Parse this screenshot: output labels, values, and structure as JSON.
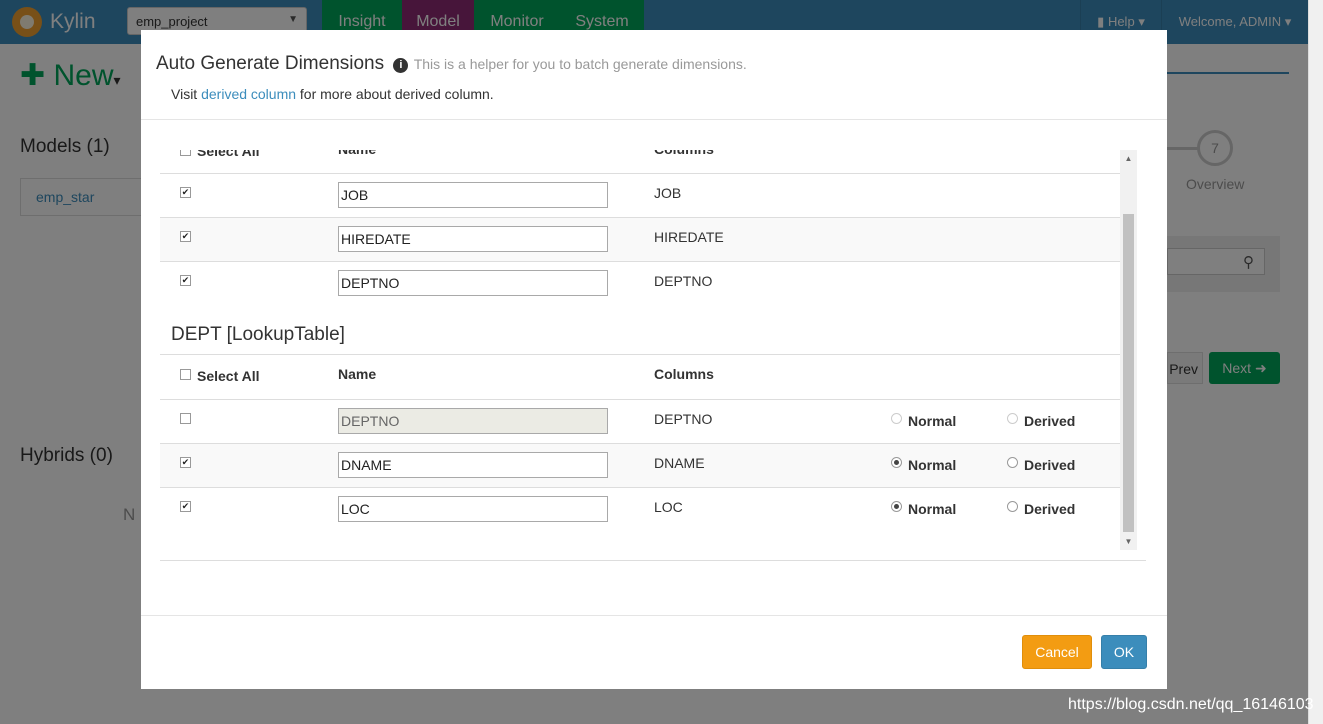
{
  "nav": {
    "brand": "Kylin",
    "project": "emp_project",
    "tabs": [
      "Insight",
      "Model",
      "Monitor",
      "System"
    ],
    "help": "Help",
    "welcome": "Welcome, ADMIN"
  },
  "background": {
    "new_label": "New",
    "models_title": "Models (1)",
    "model_item": "emp_star",
    "hybrids_title": "Hybrids (0)",
    "no_text": "N",
    "step_number": "7",
    "step_label": "Overview",
    "prev_label": "Prev",
    "next_label": "Next"
  },
  "modal": {
    "title": "Auto Generate Dimensions",
    "subtitle": "This is a helper for you to batch generate dimensions.",
    "visit_prefix": "Visit",
    "visit_link": "derived column",
    "visit_suffix": "for more about derived column.",
    "headers": {
      "select_all": "Select All",
      "name": "Name",
      "columns": "Columns"
    },
    "fact_rows": [
      {
        "checked": true,
        "name": "JOB",
        "column": "JOB"
      },
      {
        "checked": true,
        "name": "HIREDATE",
        "column": "HIREDATE"
      },
      {
        "checked": true,
        "name": "DEPTNO",
        "column": "DEPTNO"
      }
    ],
    "lookup_title": "DEPT [LookupTable]",
    "lookup_rows": [
      {
        "checked": false,
        "disabled": true,
        "name": "DEPTNO",
        "column": "DEPTNO",
        "mode": "none"
      },
      {
        "checked": true,
        "disabled": false,
        "name": "DNAME",
        "column": "DNAME",
        "mode": "Normal"
      },
      {
        "checked": true,
        "disabled": false,
        "name": "LOC",
        "column": "LOC",
        "mode": "Normal"
      }
    ],
    "radio_normal": "Normal",
    "radio_derived": "Derived",
    "cancel": "Cancel",
    "ok": "OK"
  },
  "watermark": "https://blog.csdn.net/qq_16146103",
  "colors": {
    "nav": "#3c8dbc",
    "model_tab": "#8e2a74",
    "insight_tab": "#00a65a",
    "cancel": "#f39c12",
    "ok": "#3c8dbc"
  }
}
